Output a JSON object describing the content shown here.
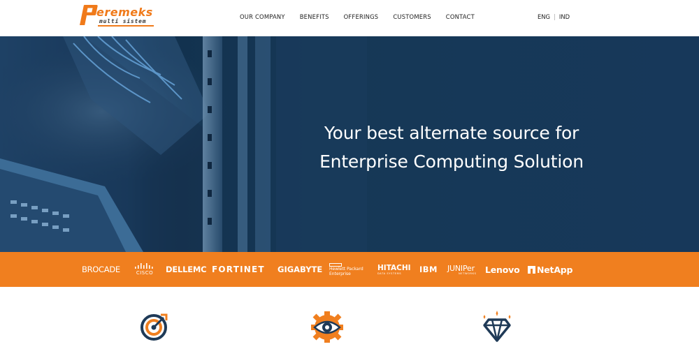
{
  "brand": {
    "name": "eremeks",
    "tagline": "multi sistem",
    "accent_color": "#f07f1f"
  },
  "nav": {
    "items": [
      {
        "label": "OUR COMPANY"
      },
      {
        "label": "BENEFITS"
      },
      {
        "label": "OFFERINGS"
      },
      {
        "label": "CUSTOMERS"
      },
      {
        "label": "CONTACT"
      }
    ]
  },
  "language": {
    "options": [
      "ENG",
      "IND"
    ],
    "separator": "|"
  },
  "hero": {
    "line1": "Your best alternate source for",
    "line2": "Enterprise Computing Solution"
  },
  "partners": {
    "brocade": "BROCADE",
    "cisco": "CISCO",
    "dellemc": "DELLEMC",
    "fortinet": "FORTINET",
    "gigabyte": "GIGABYTE",
    "hpe_line1": "Hewlett Packard",
    "hpe_line2": "Enterprise",
    "hitachi": "HITACHI",
    "hitachi_sub": "DATA SYSTEMS",
    "ibm": "IBM",
    "juniper": "JUNIPer",
    "juniper_sub": "NETWORKS",
    "lenovo": "Lenovo",
    "netapp": "NetApp"
  },
  "features": {
    "icons": [
      "target-icon",
      "eye-gear-icon",
      "diamond-icon"
    ]
  }
}
